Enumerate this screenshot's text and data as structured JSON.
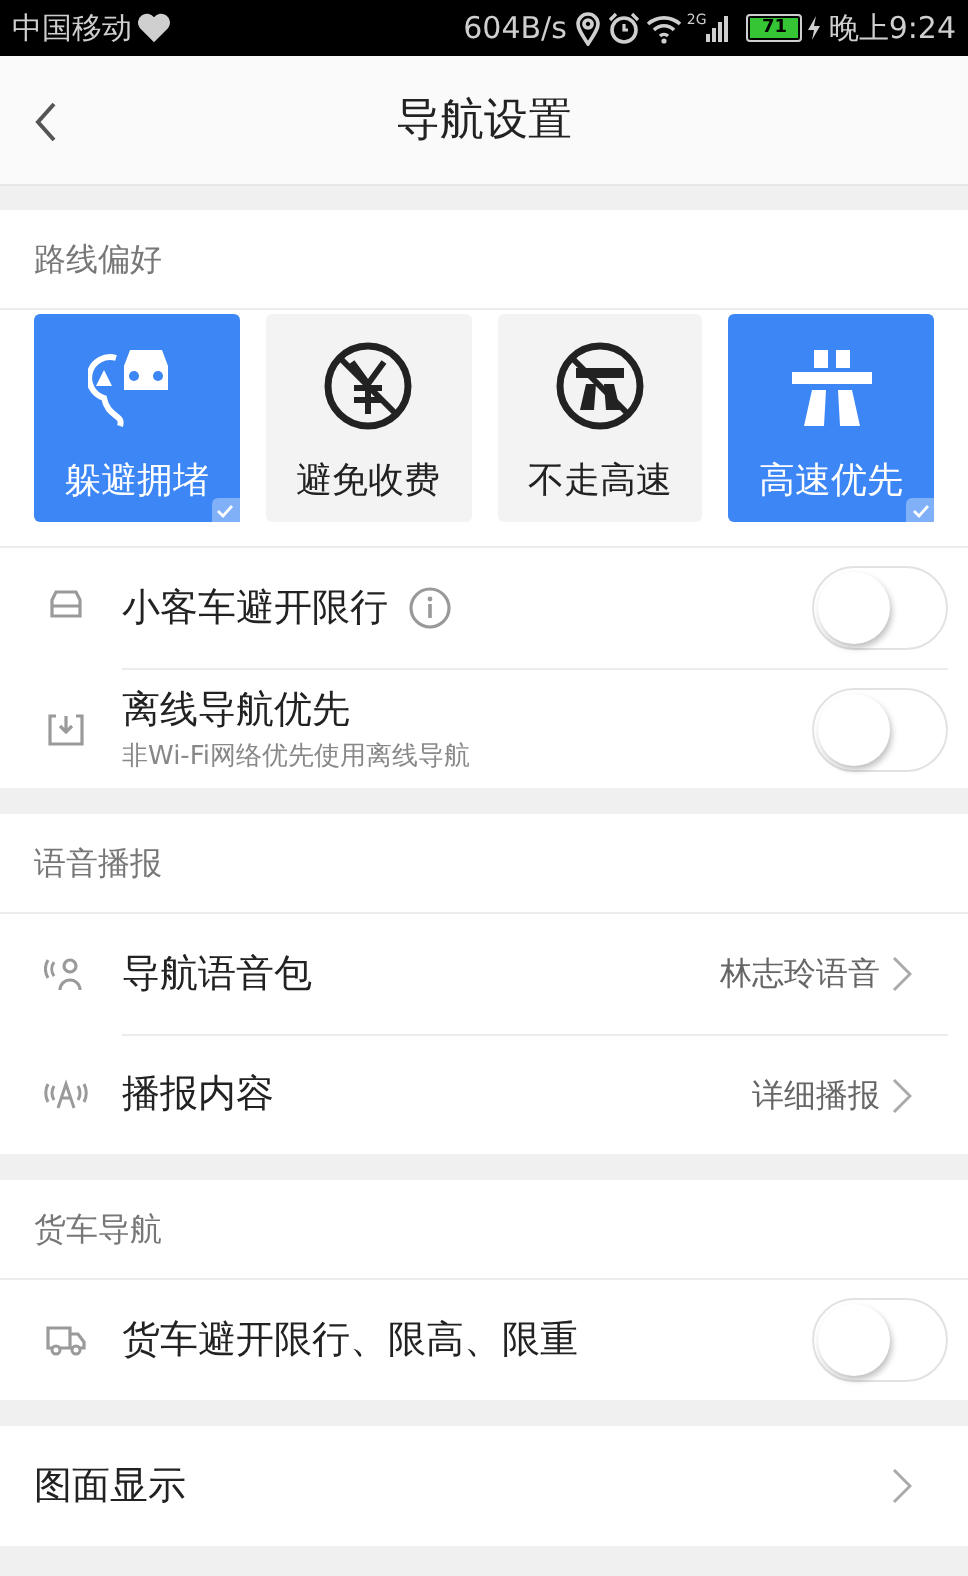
{
  "status_bar": {
    "carrier": "中国移动",
    "speed": "604B/s",
    "network": "2G",
    "battery": "71",
    "time": "晚上9:24"
  },
  "header": {
    "title": "导航设置"
  },
  "sections": [
    {
      "title": "路线偏好",
      "tiles": [
        {
          "label": "躲避拥堵",
          "selected": true
        },
        {
          "label": "避免收费",
          "selected": false
        },
        {
          "label": "不走高速",
          "selected": false
        },
        {
          "label": "高速优先",
          "selected": true
        }
      ],
      "rows": [
        {
          "kind": "toggle",
          "label": "小客车避开限行",
          "info": true,
          "on": false
        },
        {
          "kind": "toggle",
          "label": "离线导航优先",
          "subtitle": "非Wi-Fi网络优先使用离线导航",
          "on": false
        }
      ]
    },
    {
      "title": "语音播报",
      "rows": [
        {
          "kind": "link",
          "label": "导航语音包",
          "value": "林志玲语音"
        },
        {
          "kind": "link",
          "label": "播报内容",
          "value": "详细播报"
        }
      ]
    },
    {
      "title": "货车导航",
      "rows": [
        {
          "kind": "toggle",
          "label": "货车避开限行、限高、限重",
          "on": false
        }
      ]
    },
    {
      "rows": [
        {
          "kind": "link",
          "label": "图面显示"
        }
      ]
    }
  ]
}
